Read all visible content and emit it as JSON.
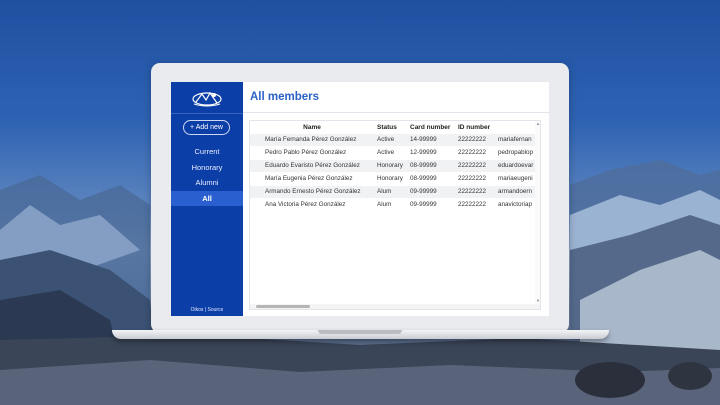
{
  "sidebar": {
    "add_new": "+ Add new",
    "items": [
      {
        "label": "Current"
      },
      {
        "label": "Honorary"
      },
      {
        "label": "Alumni"
      },
      {
        "label": "All"
      }
    ],
    "footer": "Oikos | Source"
  },
  "main": {
    "title": "All members",
    "table": {
      "headers": [
        "Name",
        "Status",
        "Card number",
        "ID number"
      ],
      "rows": [
        [
          "María Fernanda Pérez González",
          "Active",
          "14-99999",
          "22222222",
          "mariafernan"
        ],
        [
          "Pedro Pablo Pérez González",
          "Active",
          "12-99999",
          "22222222",
          "pedropablop"
        ],
        [
          "Eduardo Evaristo Pérez González",
          "Honorary",
          "08-99999",
          "22222222",
          "eduardoevar"
        ],
        [
          "María Eugenia Pérez González",
          "Honorary",
          "08-99999",
          "22222222",
          "mariaeugeni"
        ],
        [
          "Armando Ernesto Pérez González",
          "Alum",
          "09-99999",
          "22222222",
          "armandoern"
        ],
        [
          "Ana Victoria Pérez González",
          "Alum",
          "09-99999",
          "22222222",
          "anavictoriap"
        ]
      ]
    }
  },
  "colors": {
    "sidebar": "#0c3ea8",
    "sidebar_active": "#2a5fd0",
    "title": "#2a62c7"
  }
}
